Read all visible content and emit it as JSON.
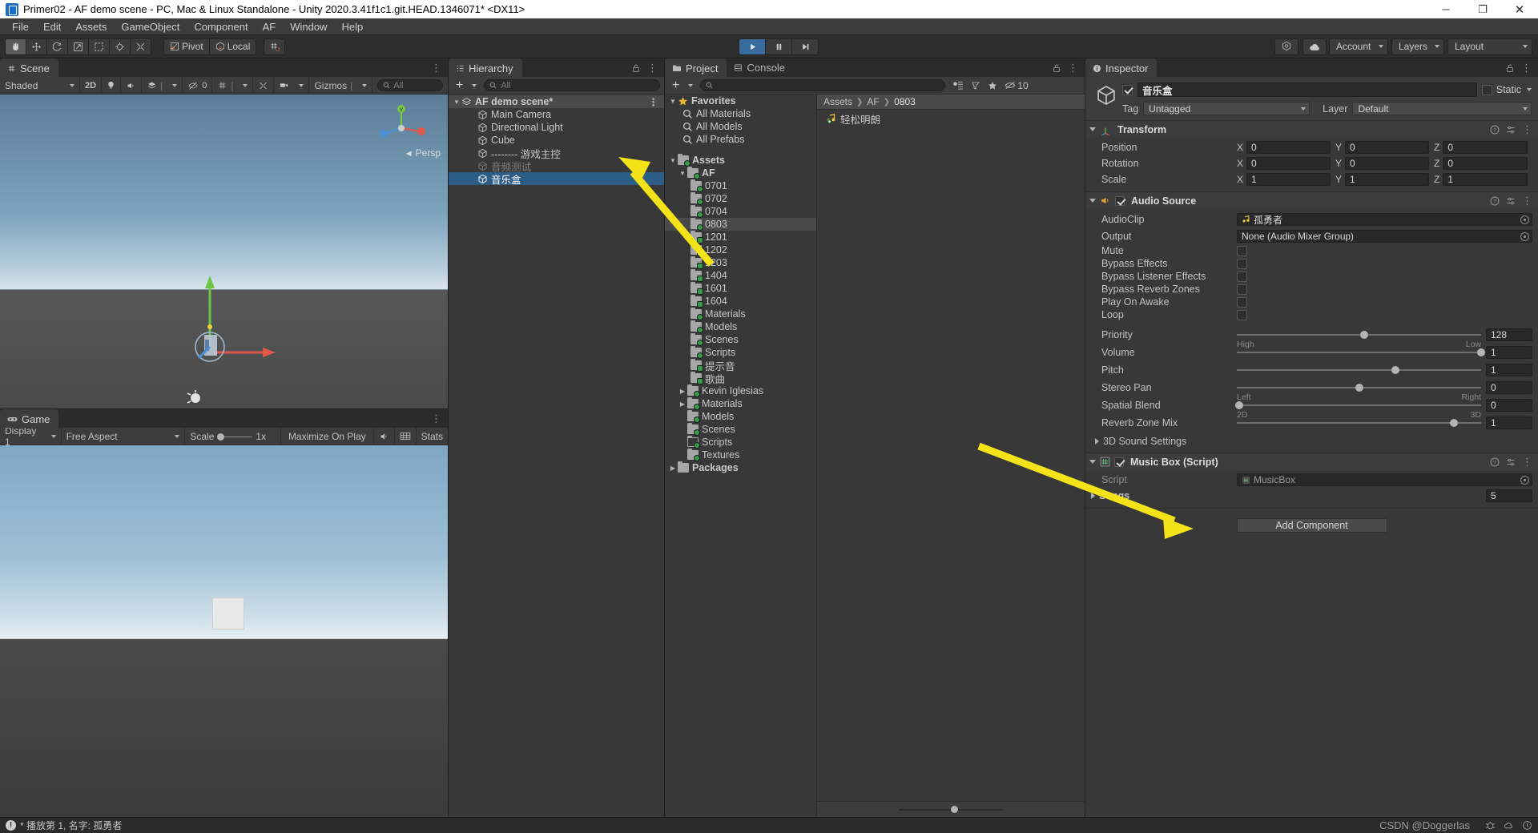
{
  "window": {
    "title": "Primer02 - AF demo scene - PC, Mac & Linux Standalone - Unity 2020.3.41f1c1.git.HEAD.1346071* <DX11>",
    "minimize": "─",
    "maximize": "❐",
    "close": "✕"
  },
  "menu": {
    "items": [
      "File",
      "Edit",
      "Assets",
      "GameObject",
      "Component",
      "AF",
      "Window",
      "Help"
    ]
  },
  "toolbar": {
    "tools": [
      "hand-tool",
      "move-tool",
      "rotate-tool",
      "scale-tool",
      "rect-tool",
      "transform-tool",
      "custom-tool"
    ],
    "pivot_label": "Pivot",
    "local_label": "Local",
    "snap_label": "grid-snap",
    "play_label": "play",
    "pause_label": "pause",
    "step_label": "step",
    "collab_label": "collab",
    "cloud_label": "cloud",
    "account_label": "Account",
    "layers_label": "Layers",
    "layout_label": "Layout"
  },
  "scene": {
    "tab_label": "Scene",
    "shading": "Shaded",
    "mode_2d": "2D",
    "audio_off_count": "0",
    "gizmos_label": "Gizmos",
    "search_placeholder": "All",
    "persp_label": "Persp",
    "gizmo_axes": [
      "Y",
      "X",
      "Z"
    ]
  },
  "game": {
    "tab_label": "Game",
    "display": "Display 1",
    "aspect": "Free Aspect",
    "scale_label": "Scale",
    "scale_value": "1x",
    "maximize": "Maximize On Play",
    "stats": "Stats"
  },
  "hierarchy": {
    "tab_label": "Hierarchy",
    "search_placeholder": "All",
    "scene_name": "AF demo scene*",
    "items": [
      {
        "label": "Main Camera",
        "state": "normal"
      },
      {
        "label": "Directional Light",
        "state": "normal"
      },
      {
        "label": "Cube",
        "state": "normal"
      },
      {
        "label": "-------- 游戏主控",
        "state": "normal"
      },
      {
        "label": "音频测试",
        "state": "disabled"
      },
      {
        "label": "音乐盒",
        "state": "selected"
      }
    ]
  },
  "project": {
    "tab_label": "Project",
    "console_tab_label": "Console",
    "search_placeholder": "",
    "favorites_label": "Favorites",
    "favorites": [
      "All Materials",
      "All Models",
      "All Prefabs"
    ],
    "assets_label": "Assets",
    "af_label": "AF",
    "af_children": [
      {
        "label": "0701",
        "badge": "plus"
      },
      {
        "label": "0702",
        "badge": "plus"
      },
      {
        "label": "0704",
        "badge": "plus"
      },
      {
        "label": "0803",
        "badge": "plus",
        "highlight": true
      },
      {
        "label": "1201",
        "badge": "check"
      },
      {
        "label": "1202",
        "badge": "check"
      },
      {
        "label": "1203",
        "badge": "check"
      },
      {
        "label": "1404",
        "badge": "check"
      },
      {
        "label": "1601",
        "badge": "check"
      },
      {
        "label": "1604",
        "badge": "check"
      },
      {
        "label": "Materials",
        "badge": "plus"
      },
      {
        "label": "Models",
        "badge": "plus"
      },
      {
        "label": "Scenes",
        "badge": "plus"
      },
      {
        "label": "Scripts",
        "badge": "plus"
      },
      {
        "label": "提示音",
        "badge": "check"
      },
      {
        "label": "歌曲",
        "badge": "check"
      }
    ],
    "assets_children": [
      {
        "label": "Kevin Iglesias",
        "expandable": true,
        "badge": "plus"
      },
      {
        "label": "Materials",
        "expandable": true,
        "badge": "plus"
      },
      {
        "label": "Models",
        "expandable": false,
        "badge": "plus"
      },
      {
        "label": "Scenes",
        "expandable": false,
        "badge": "plus"
      },
      {
        "label": "Scripts",
        "expandable": false,
        "badge": "plus",
        "outline": true
      },
      {
        "label": "Textures",
        "expandable": false,
        "badge": "plus"
      }
    ],
    "packages_label": "Packages",
    "breadcrumb": [
      "Assets",
      "AF",
      "0803"
    ],
    "files": [
      {
        "label": "轻松明朗",
        "icon": "audio-clip-icon"
      }
    ]
  },
  "inspector": {
    "tab_label": "Inspector",
    "object_name": "音乐盒",
    "enabled": true,
    "static_label": "Static",
    "tag_label": "Tag",
    "tag_value": "Untagged",
    "layer_label": "Layer",
    "layer_value": "Default",
    "transform": {
      "title": "Transform",
      "rows": [
        {
          "name": "Position",
          "x": "0",
          "y": "0",
          "z": "0"
        },
        {
          "name": "Rotation",
          "x": "0",
          "y": "0",
          "z": "0"
        },
        {
          "name": "Scale",
          "x": "1",
          "y": "1",
          "z": "1"
        }
      ],
      "axes": [
        "X",
        "Y",
        "Z"
      ]
    },
    "audio_source": {
      "title": "Audio Source",
      "enabled": true,
      "audioclip_label": "AudioClip",
      "audioclip_value": "孤勇者",
      "output_label": "Output",
      "output_value": "None (Audio Mixer Group)",
      "toggles": [
        {
          "label": "Mute",
          "checked": false
        },
        {
          "label": "Bypass Effects",
          "checked": false
        },
        {
          "label": "Bypass Listener Effects",
          "checked": false
        },
        {
          "label": "Bypass Reverb Zones",
          "checked": false
        },
        {
          "label": "Play On Awake",
          "checked": false
        },
        {
          "label": "Loop",
          "checked": false
        }
      ],
      "sliders": [
        {
          "label": "Priority",
          "value": "128",
          "pct": 52,
          "min_label": "High",
          "max_label": "Low"
        },
        {
          "label": "Volume",
          "value": "1",
          "pct": 100,
          "min_label": "",
          "max_label": ""
        },
        {
          "label": "Pitch",
          "value": "1",
          "pct": 65,
          "min_label": "",
          "max_label": ""
        },
        {
          "label": "Stereo Pan",
          "value": "0",
          "pct": 50,
          "min_label": "Left",
          "max_label": "Right"
        },
        {
          "label": "Spatial Blend",
          "value": "0",
          "pct": 1,
          "min_label": "2D",
          "max_label": "3D"
        },
        {
          "label": "Reverb Zone Mix",
          "value": "1",
          "pct": 89,
          "min_label": "",
          "max_label": ""
        }
      ],
      "sound3d_label": "3D Sound Settings"
    },
    "music_box": {
      "title": "Music Box (Script)",
      "enabled": true,
      "script_label": "Script",
      "script_value": "MusicBox",
      "songs_label": "Songs",
      "songs_count": "5"
    },
    "add_component_label": "Add Component"
  },
  "status": {
    "message": "* 播放第 1, 名字: 孤勇者",
    "watermark": "CSDN @Doggerlas"
  },
  "colors": {
    "accent_blue": "#2c5d87",
    "play_blue": "#3a6b9e",
    "arrow_yellow": "#f5e31a",
    "folder_green": "#2f9e44",
    "panel_bg": "#383838"
  }
}
